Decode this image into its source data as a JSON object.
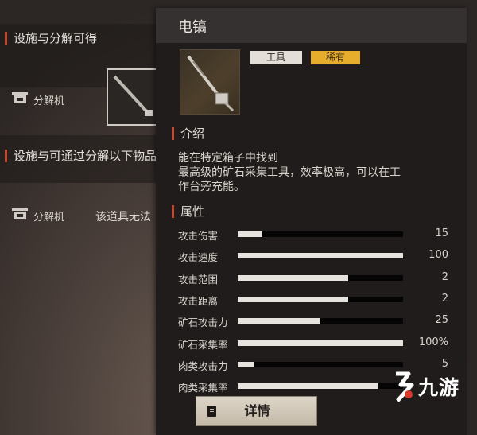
{
  "background": {
    "section1_title": "设施与分解可得",
    "section1_facility": "分解机",
    "section2_title": "设施与可通过分解以下物品",
    "section2_facility": "分解机",
    "section2_note": "该道具无法"
  },
  "item": {
    "name": "电镐",
    "icon": "electric-pickaxe-icon",
    "tags": {
      "type": "工具",
      "rarity": "稀有"
    },
    "rarity_color": "#e6ac2b",
    "intro_header": "介绍",
    "description": [
      "能在特定箱子中找到",
      "最高级的矿石采集工具，效率极高，可以在工",
      "作台旁充能。"
    ],
    "attributes_header": "属性",
    "stats": [
      {
        "label": "攻击伤害",
        "value": "15",
        "fill": 0.15
      },
      {
        "label": "攻击速度",
        "value": "100",
        "fill": 1.0
      },
      {
        "label": "攻击范围",
        "value": "2",
        "fill": 0.67
      },
      {
        "label": "攻击距离",
        "value": "2",
        "fill": 0.67
      },
      {
        "label": "矿石攻击力",
        "value": "25",
        "fill": 0.5
      },
      {
        "label": "矿石采集率",
        "value": "100%",
        "fill": 1.0
      },
      {
        "label": "肉类攻击力",
        "value": "5",
        "fill": 0.1
      },
      {
        "label": "肉类采集率",
        "value": "",
        "fill": 0.85
      }
    ],
    "detail_button": "详情"
  },
  "watermark": {
    "text": "九游",
    "logo": "jiuyou-logo-icon"
  },
  "colors": {
    "accent_red": "#c8462e",
    "stat_fill": "#e6e3de"
  }
}
